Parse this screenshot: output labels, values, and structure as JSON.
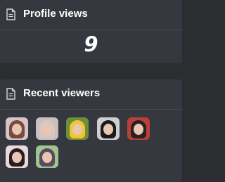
{
  "profile_views": {
    "title": "Profile views",
    "count": "9",
    "icon": "document-icon"
  },
  "recent_viewers": {
    "title": "Recent viewers",
    "icon": "document-icon",
    "avatars": [
      {
        "name": "viewer-avatar-1",
        "bg": "#d8c3c8",
        "hair": "#7a4a3a"
      },
      {
        "name": "viewer-avatar-2",
        "bg": "#c9bfc3",
        "hair": "#d9c7bd"
      },
      {
        "name": "viewer-avatar-3",
        "bg": "#6b8f3a",
        "hair": "#f2c531"
      },
      {
        "name": "viewer-avatar-4",
        "bg": "#cfcfd2",
        "hair": "#1c1a1d"
      },
      {
        "name": "viewer-avatar-5",
        "bg": "#b9403a",
        "hair": "#2a1f22"
      },
      {
        "name": "viewer-avatar-6",
        "bg": "#ead8dc",
        "hair": "#2b1c1e"
      },
      {
        "name": "viewer-avatar-7",
        "bg": "#9ec58f",
        "hair": "#5b4a5f"
      }
    ]
  }
}
